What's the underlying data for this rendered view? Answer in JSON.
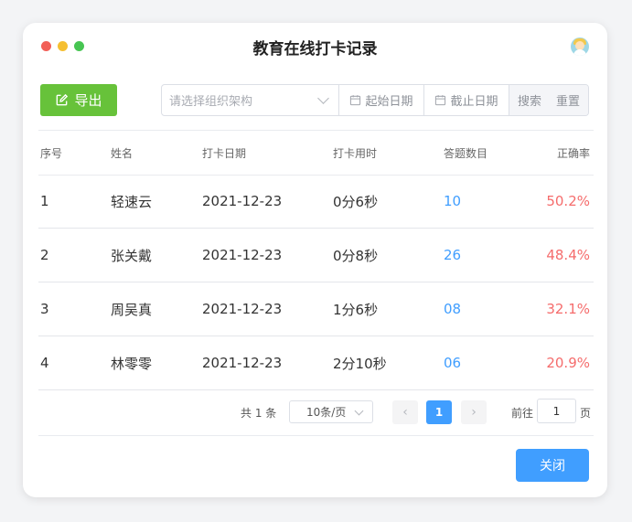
{
  "window": {
    "title": "教育在线打卡记录",
    "controls": [
      "close",
      "minimize",
      "maximize"
    ],
    "avatar_icon": "user-avatar-icon"
  },
  "toolbar": {
    "export_label": "导出",
    "export_icon": "edit-export-icon",
    "org_select_placeholder": "请选择组织架构",
    "start_date_placeholder": "起始日期",
    "end_date_placeholder": "截止日期",
    "search_label": "搜索",
    "reset_label": "重置"
  },
  "table": {
    "headers": [
      "序号",
      "姓名",
      "打卡日期",
      "打卡用时",
      "答题数目",
      "正确率"
    ],
    "rows": [
      {
        "no": "1",
        "name": "轻速云",
        "date": "2021-12-23",
        "duration": "0分6秒",
        "count": "10",
        "accuracy": "50.2%"
      },
      {
        "no": "2",
        "name": "张关戴",
        "date": "2021-12-23",
        "duration": "0分8秒",
        "count": "26",
        "accuracy": "48.4%"
      },
      {
        "no": "3",
        "name": "周吴真",
        "date": "2021-12-23",
        "duration": "1分6秒",
        "count": "08",
        "accuracy": "32.1%"
      },
      {
        "no": "4",
        "name": "林零零",
        "date": "2021-12-23",
        "duration": "2分10秒",
        "count": "06",
        "accuracy": "20.9%"
      }
    ]
  },
  "pagination": {
    "total_text": "共 1 条",
    "page_size": "10条/页",
    "current_page": "1",
    "goto_label": "前往",
    "goto_value": "1",
    "page_suffix": "页"
  },
  "footer": {
    "close_label": "关闭"
  },
  "colors": {
    "export_green": "#67c23a",
    "primary_blue": "#409eff",
    "accuracy_red": "#f56c6c"
  }
}
